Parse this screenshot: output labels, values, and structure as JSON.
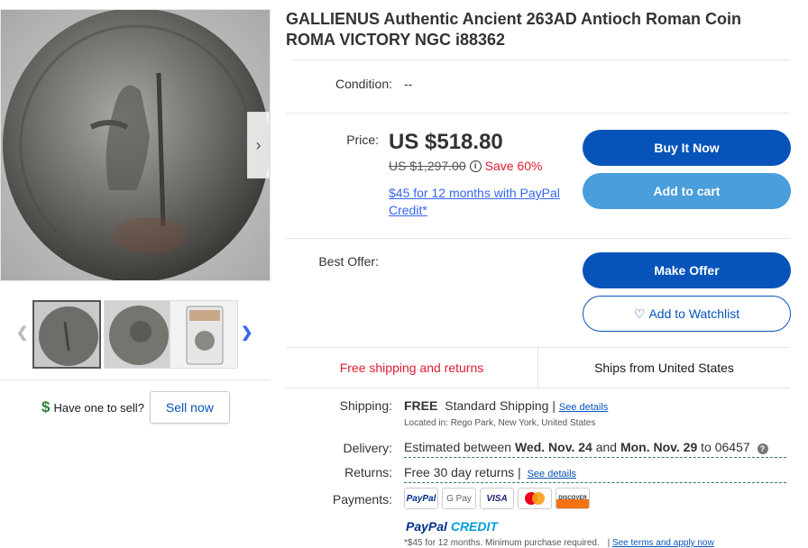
{
  "listing": {
    "title": "GALLIENUS Authentic Ancient 263AD Antioch Roman Coin ROMA VICTORY NGC i88362"
  },
  "condition": {
    "label": "Condition:",
    "value": "--"
  },
  "price": {
    "label": "Price:",
    "current": "US $518.80",
    "was": "US $1,297.00",
    "save": "Save 60%",
    "credit_offer": "$45 for 12 months with PayPal Credit*"
  },
  "buttons": {
    "buy_now": "Buy It Now",
    "add_to_cart": "Add to cart",
    "make_offer": "Make Offer",
    "watchlist": "Add to Watchlist"
  },
  "best_offer": {
    "label": "Best Offer:"
  },
  "shipping_banner": {
    "free": "Free shipping and returns",
    "ships_from": "Ships from United States"
  },
  "shipping": {
    "label": "Shipping:",
    "free": "FREE",
    "method": "Standard Shipping |",
    "details_link": "See details",
    "location": "Located in:  Rego Park, New York, United States"
  },
  "delivery": {
    "label": "Delivery:",
    "prefix": "Estimated between",
    "start": "Wed. Nov. 24",
    "and": "and",
    "end": "Mon. Nov. 29",
    "to": "to 06457"
  },
  "returns": {
    "label": "Returns:",
    "value": "Free 30 day returns |",
    "details_link": "See details"
  },
  "payments": {
    "label": "Payments:",
    "methods": [
      "PayPal",
      "G Pay",
      "VISA",
      "Mastercard",
      "DISCOVER"
    ]
  },
  "paypal_credit": {
    "logo_paypal": "PayPal",
    "logo_credit": "CREDIT",
    "footnote": "*$45 for 12 months. Minimum purchase required.",
    "terms_link": "See terms and apply now"
  },
  "sell": {
    "question": "Have one to sell?",
    "button": "Sell now"
  },
  "colors": {
    "primary": "#0654ba",
    "secondary": "#4a9edb",
    "sale_red": "#dd1e31",
    "link_blue": "#3665f3"
  }
}
